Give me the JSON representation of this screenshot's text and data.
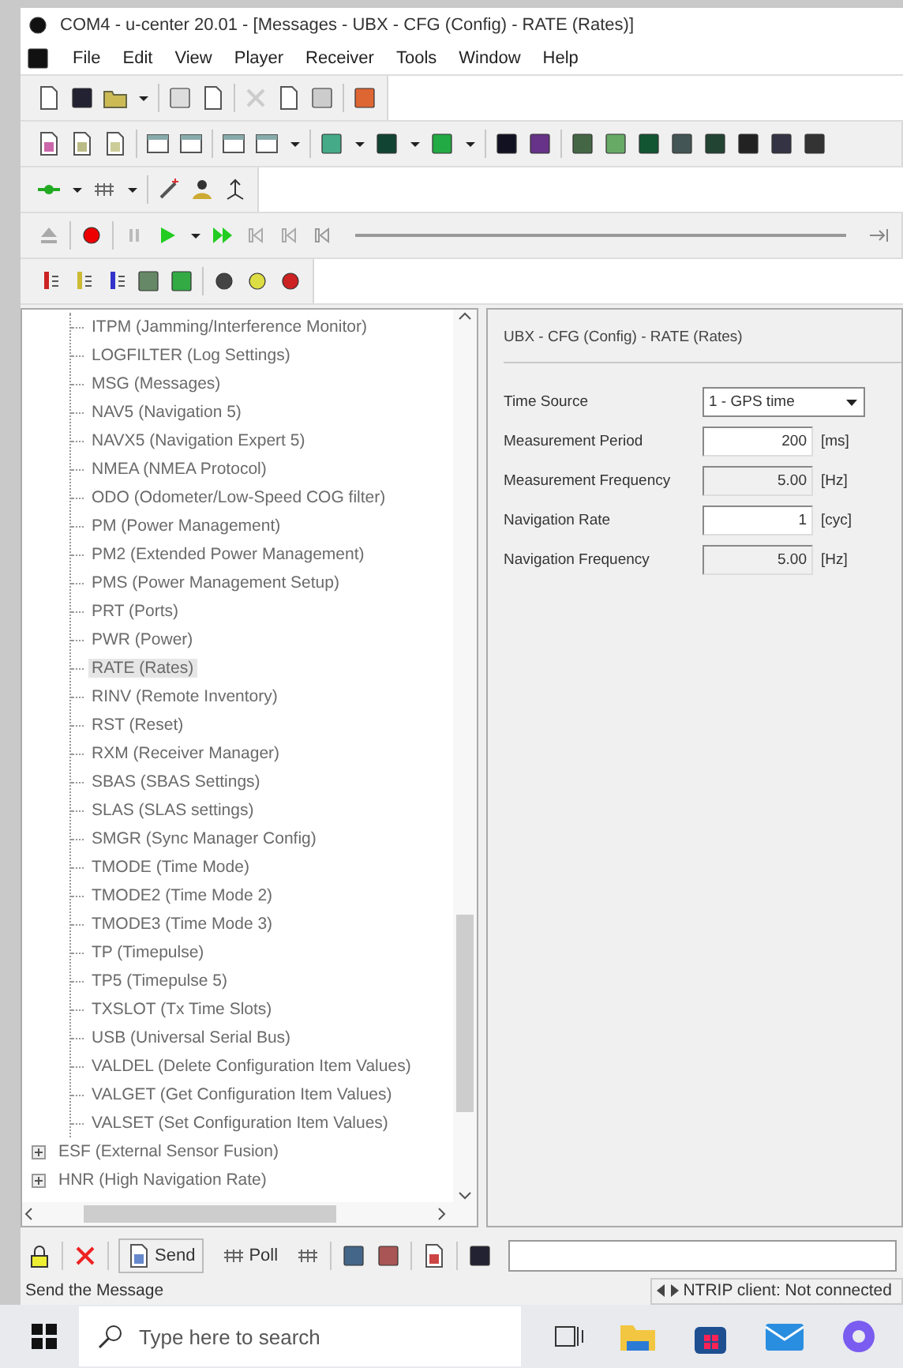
{
  "window": {
    "title": "COM4 - u-center 20.01 - [Messages - UBX - CFG (Config) - RATE (Rates)]"
  },
  "menu": [
    "File",
    "Edit",
    "View",
    "Player",
    "Receiver",
    "Tools",
    "Window",
    "Help"
  ],
  "tree": {
    "items": [
      {
        "children": [
          {
            "label": "ITPM (Jamming/Interference Monitor)",
            "selected": false
          },
          {
            "label": "LOGFILTER (Log Settings)",
            "selected": false
          },
          {
            "label": "MSG (Messages)",
            "selected": false
          },
          {
            "label": "NAV5 (Navigation 5)",
            "selected": false
          },
          {
            "label": "NAVX5 (Navigation Expert 5)",
            "selected": false
          },
          {
            "label": "NMEA (NMEA Protocol)",
            "selected": false
          },
          {
            "label": "ODO (Odometer/Low-Speed COG filter)",
            "selected": false
          },
          {
            "label": "PM (Power Management)",
            "selected": false
          },
          {
            "label": "PM2 (Extended Power Management)",
            "selected": false
          },
          {
            "label": "PMS (Power Management Setup)",
            "selected": false
          },
          {
            "label": "PRT (Ports)",
            "selected": false
          },
          {
            "label": "PWR (Power)",
            "selected": false
          },
          {
            "label": "RATE (Rates)",
            "selected": true
          },
          {
            "label": "RINV (Remote Inventory)",
            "selected": false
          },
          {
            "label": "RST (Reset)",
            "selected": false
          },
          {
            "label": "RXM (Receiver Manager)",
            "selected": false
          },
          {
            "label": "SBAS (SBAS Settings)",
            "selected": false
          },
          {
            "label": "SLAS (SLAS settings)",
            "selected": false
          },
          {
            "label": "SMGR (Sync Manager Config)",
            "selected": false
          },
          {
            "label": "TMODE (Time Mode)",
            "selected": false
          },
          {
            "label": "TMODE2 (Time Mode 2)",
            "selected": false
          },
          {
            "label": "TMODE3 (Time Mode 3)",
            "selected": false
          },
          {
            "label": "TP (Timepulse)",
            "selected": false
          },
          {
            "label": "TP5 (Timepulse 5)",
            "selected": false
          },
          {
            "label": "TXSLOT (Tx Time Slots)",
            "selected": false
          },
          {
            "label": "USB (Universal Serial Bus)",
            "selected": false
          },
          {
            "label": "VALDEL (Delete Configuration Item Values)",
            "selected": false
          },
          {
            "label": "VALGET (Get Configuration Item Values)",
            "selected": false
          },
          {
            "label": "VALSET (Set Configuration Item Values)",
            "selected": false
          }
        ]
      },
      {
        "label": "ESF (External Sensor Fusion)",
        "expanded": false,
        "selected": false
      },
      {
        "label": "HNR (High Navigation Rate)",
        "expanded": false,
        "selected": false
      }
    ]
  },
  "panel": {
    "header": "UBX - CFG (Config) - RATE (Rates)",
    "fields": [
      {
        "kind": "select",
        "label": "Time Source",
        "value": "1 - GPS time"
      },
      {
        "kind": "input",
        "label": "Measurement Period",
        "value": "200",
        "unit": "[ms]"
      },
      {
        "kind": "readonly",
        "label": "Measurement Frequency",
        "value": "5.00",
        "unit": "[Hz]"
      },
      {
        "kind": "input",
        "label": "Navigation Rate",
        "value": "1",
        "unit": "[cyc]"
      },
      {
        "kind": "readonly",
        "label": "Navigation Frequency",
        "value": "5.00",
        "unit": "[Hz]"
      }
    ]
  },
  "bottom_toolbar": {
    "send": "Send",
    "poll": "Poll"
  },
  "status_bar": {
    "message": "Send the Message",
    "ntrip": "NTRIP client: Not connected"
  },
  "taskbar": {
    "search_placeholder": "Type here to search"
  }
}
